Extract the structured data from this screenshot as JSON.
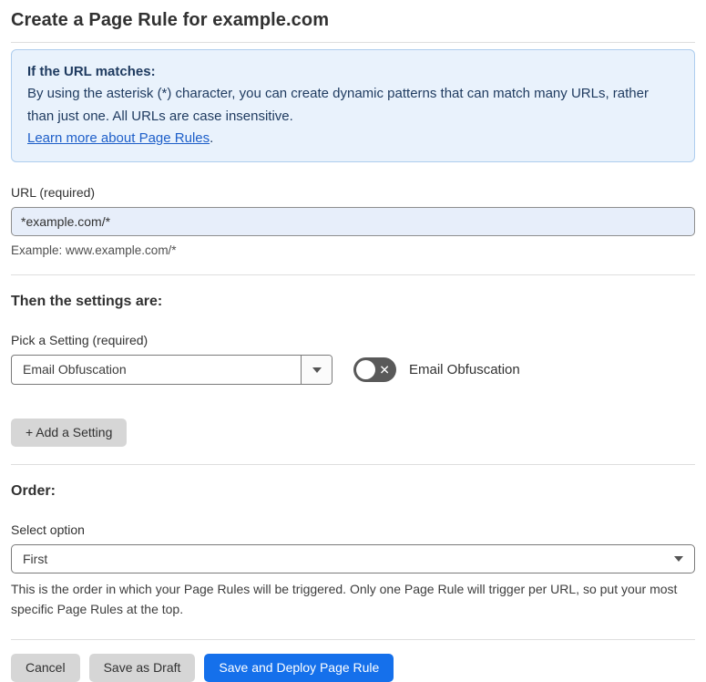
{
  "page": {
    "title": "Create a Page Rule for example.com"
  },
  "info_box": {
    "heading": "If the URL matches:",
    "body": "By using the asterisk (*) character, you can create dynamic patterns that can match many URLs, rather than just one. All URLs are case insensitive.",
    "link_label": "Learn more about Page Rules",
    "link_suffix": "."
  },
  "url_field": {
    "label": "URL (required)",
    "value": "*example.com/*",
    "helper": "Example: www.example.com/*"
  },
  "settings_section": {
    "heading": "Then the settings are:",
    "setting_label": "Pick a Setting (required)",
    "setting_value": "Email Obfuscation",
    "toggle_label": "Email Obfuscation",
    "toggle_state": "off",
    "toggle_glyph": "✕",
    "add_setting_label": "+ Add a Setting"
  },
  "order_section": {
    "heading": "Order:",
    "select_label": "Select option",
    "select_value": "First",
    "helper": "This is the order in which your Page Rules will be triggered. Only one Page Rule will trigger per URL, so put your most specific Page Rules at the top."
  },
  "footer": {
    "cancel_label": "Cancel",
    "save_draft_label": "Save as Draft",
    "save_deploy_label": "Save and Deploy Page Rule"
  },
  "colors": {
    "accent_blue": "#1570eb",
    "info_background": "#e9f2fc",
    "info_border": "#aecdee",
    "info_text": "#1e3a5f",
    "link_blue": "#1e5fc9",
    "url_input_background": "#e7eefa",
    "toggle_off": "#595959",
    "gray_button": "#d6d6d6"
  }
}
